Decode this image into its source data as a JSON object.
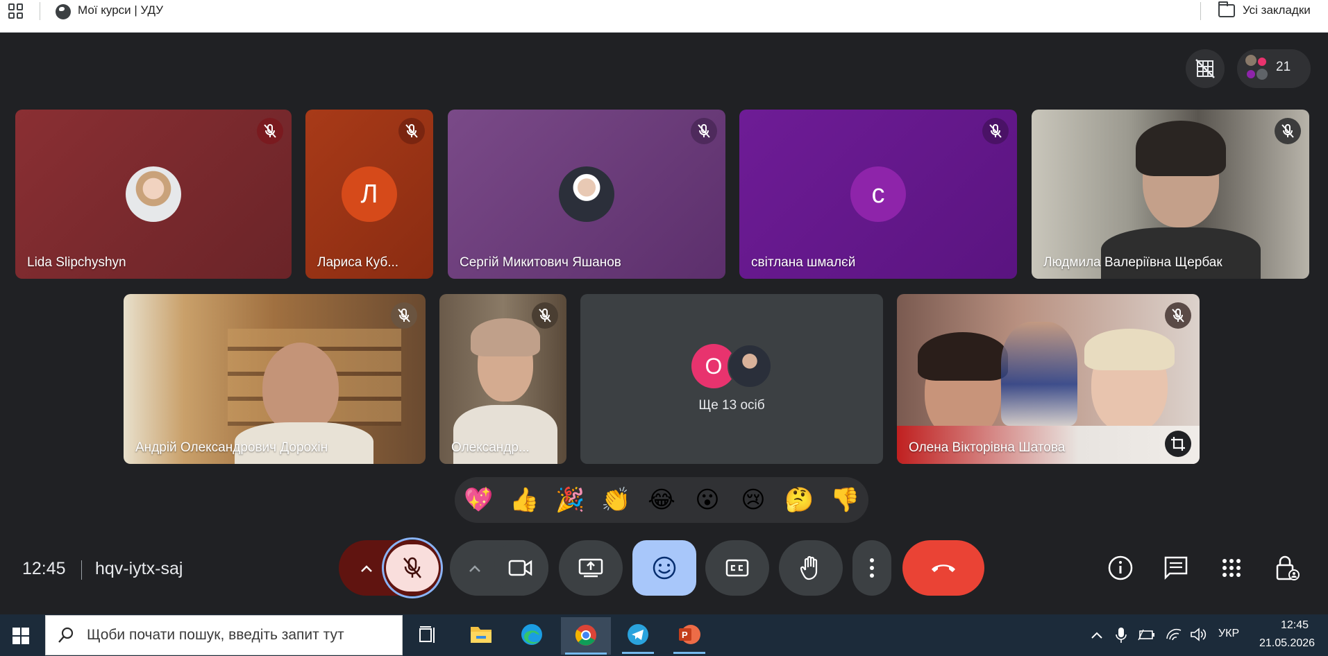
{
  "browser": {
    "bookmark_title": "Мої курси | УДУ",
    "all_bookmarks": "Усі закладки"
  },
  "meet": {
    "participant_count": "21",
    "tiles_row1": [
      {
        "name": "Lida Slipchyshyn",
        "type": "photo-avatar",
        "bg": "#7d2b30"
      },
      {
        "name": "Лариса Куб...",
        "type": "letter",
        "letter": "Л",
        "bg": "#a43516",
        "avatar_color": "#d64a1a"
      },
      {
        "name": "Сергій Микитович Яшанов",
        "type": "photo-avatar",
        "bg": "#6b3d7c"
      },
      {
        "name": "світлана шмалєй",
        "type": "letter",
        "letter": "с",
        "bg": "#6a1b9a",
        "avatar_color": "#8e24aa"
      },
      {
        "name": "Людмила Валеріївна Щербак",
        "type": "video",
        "bg": "#8c8a80"
      }
    ],
    "tiles_row2": [
      {
        "name": "Андрій Олександрович Дорохін",
        "type": "video",
        "bg": "#8c6a4a"
      },
      {
        "name": "Олександр...",
        "type": "video",
        "bg": "#7a6a58"
      },
      {
        "name": "Ще 13 осіб",
        "type": "others",
        "letter": "О",
        "bg": "#3c4043",
        "avatar_color": "#e8336e"
      },
      {
        "name": "Олена Вікторівна Шатова",
        "type": "video",
        "bg": "#9e7d72"
      }
    ],
    "emojis": [
      "💖",
      "👍",
      "🎉",
      "👏",
      "😂",
      "😮",
      "😢",
      "🤔",
      "👎"
    ],
    "clock": "12:45",
    "meeting_code": "hqv-iytx-saj",
    "colors": {
      "end_call": "#ea4335",
      "mic_off_bg": "#f9dedc",
      "emoji_active": "#a8c7fa",
      "dark_red": "#601410"
    }
  },
  "taskbar": {
    "search_placeholder": "Щоби почати пошук, введіть запит тут",
    "language": "УКР",
    "time": "12:45",
    "date": "21.05.2026"
  }
}
